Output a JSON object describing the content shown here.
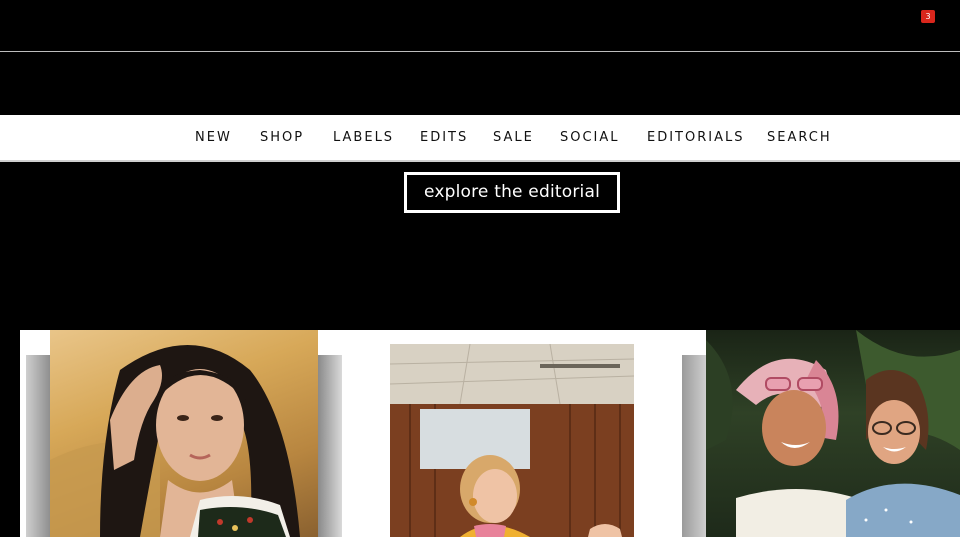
{
  "header": {
    "cart": {
      "icon": "shopping-bag-icon",
      "badge_count": "3"
    }
  },
  "nav": {
    "items": [
      {
        "label": "NEW"
      },
      {
        "label": "SHOP"
      },
      {
        "label": "LABELS"
      },
      {
        "label": "EDITS"
      },
      {
        "label": "SALE"
      },
      {
        "label": "SOCIAL"
      },
      {
        "label": "EDITORIALS"
      },
      {
        "label": "SEARCH"
      }
    ]
  },
  "hero": {
    "cta_label": "explore the editorial"
  },
  "colors": {
    "background": "#000000",
    "nav_background": "#ffffff",
    "badge": "#d9261c"
  }
}
